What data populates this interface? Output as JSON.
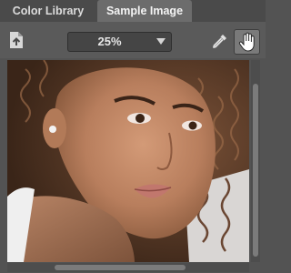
{
  "tabs": [
    {
      "label": "Color Library",
      "active": false
    },
    {
      "label": "Sample Image",
      "active": true
    }
  ],
  "toolbar": {
    "zoom_value": "25%",
    "icons": {
      "export": "export-image-icon",
      "zoom_dropdown": "chevron-down-icon",
      "color_picker": "eyedropper-icon",
      "hand_tool": "hand-icon"
    }
  },
  "image": {
    "subject": "portrait-photo"
  },
  "colors": {
    "panel_bg": "#535353",
    "tab_bar_bg": "#4a4a4a",
    "active_tab_bg": "#6c6c6c",
    "toolbar_bg": "#5a5a5a",
    "active_tool_bg": "#7a7a7a"
  }
}
